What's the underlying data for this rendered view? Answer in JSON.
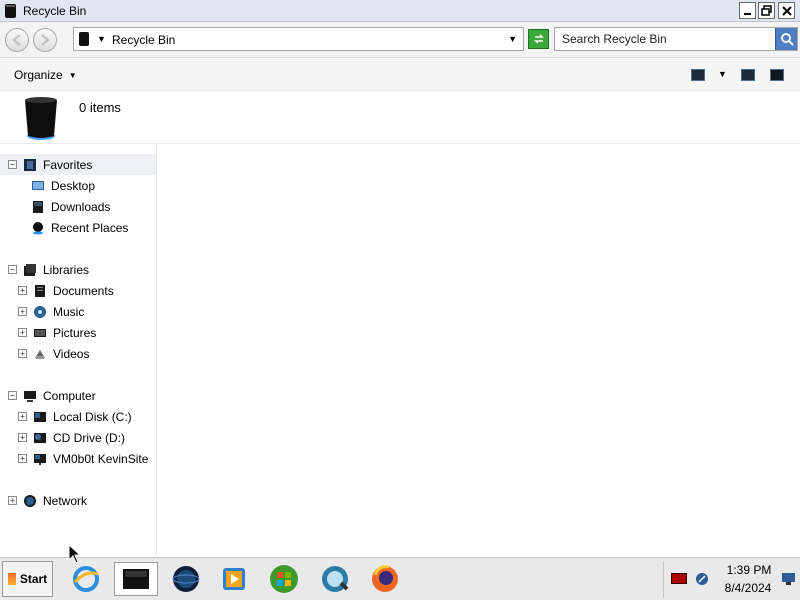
{
  "window": {
    "title": "Recycle Bin",
    "controls": {
      "minimize": "_",
      "maximize": "▭",
      "close": "✕"
    }
  },
  "address": {
    "path": "Recycle Bin",
    "search_placeholder": "Search Recycle Bin"
  },
  "toolbar": {
    "organize_label": "Organize"
  },
  "details": {
    "item_count": "0 items"
  },
  "nav": {
    "favorites": {
      "label": "Favorites",
      "toggle": "−"
    },
    "favorites_items": [
      {
        "label": "Desktop"
      },
      {
        "label": "Downloads"
      },
      {
        "label": "Recent Places"
      }
    ],
    "libraries": {
      "label": "Libraries",
      "toggle": "−"
    },
    "libraries_items": [
      {
        "label": "Documents",
        "toggle": "+"
      },
      {
        "label": "Music",
        "toggle": "+"
      },
      {
        "label": "Pictures",
        "toggle": "+"
      },
      {
        "label": "Videos",
        "toggle": "+"
      }
    ],
    "computer": {
      "label": "Computer",
      "toggle": "−"
    },
    "computer_items": [
      {
        "label": "Local Disk (C:)",
        "toggle": "+"
      },
      {
        "label": "CD Drive (D:)",
        "toggle": "+"
      },
      {
        "label": "VM0b0t KevinSite",
        "toggle": "+"
      }
    ],
    "network": {
      "label": "Network",
      "toggle": "+"
    }
  },
  "taskbar": {
    "start_label": "Start",
    "apps": [
      "internet-explorer-icon",
      "recycle-bin-window-icon",
      "globe-icon",
      "media-player-icon",
      "windows-logo-icon",
      "network-globe-icon",
      "firefox-icon"
    ],
    "clock_time": "1:39 PM",
    "clock_date": "8/4/2024"
  },
  "colors": {
    "titlebar": "#dfe6f2",
    "search_button": "#4f7ec2",
    "refresh_button": "#3aa93a",
    "recycle_bin_glow": "#1e90ff"
  }
}
